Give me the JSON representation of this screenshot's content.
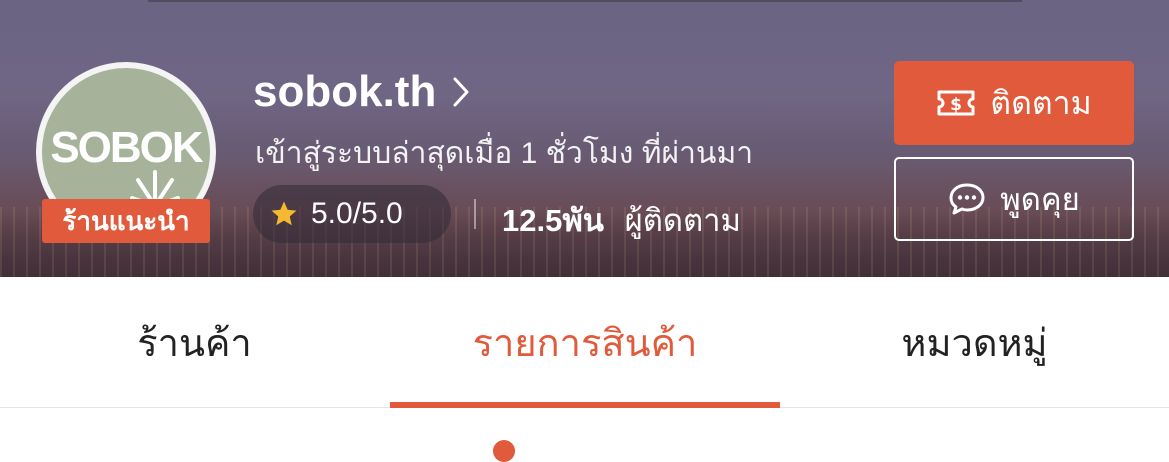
{
  "shop": {
    "name": "sobok.th",
    "avatar_logo_text": "SOBOK",
    "badge": "ร้านแนะนำ",
    "last_active": "เข้าสู่ระบบล่าสุดเมื่อ 1 ชั่วโมง ที่ผ่านมา",
    "rating": "5.0/5.0",
    "followers_count": "12.5พัน",
    "followers_label": "ผู้ติดตาม"
  },
  "actions": {
    "follow_label": "ติดตาม",
    "chat_label": "พูดคุย"
  },
  "tabs": [
    {
      "label": "ร้านค้า",
      "active": false
    },
    {
      "label": "รายการสินค้า",
      "active": true
    },
    {
      "label": "หมวดหมู่",
      "active": false
    }
  ],
  "colors": {
    "accent": "#e05a3b",
    "badge_bg": "#e05a3b",
    "avatar_bg": "#a6b29a",
    "star": "#f5b82e"
  },
  "icons": {
    "chevron": "chevron-right-icon",
    "star": "star-icon",
    "follow": "ticket-icon",
    "chat": "chat-bubble-icon"
  }
}
